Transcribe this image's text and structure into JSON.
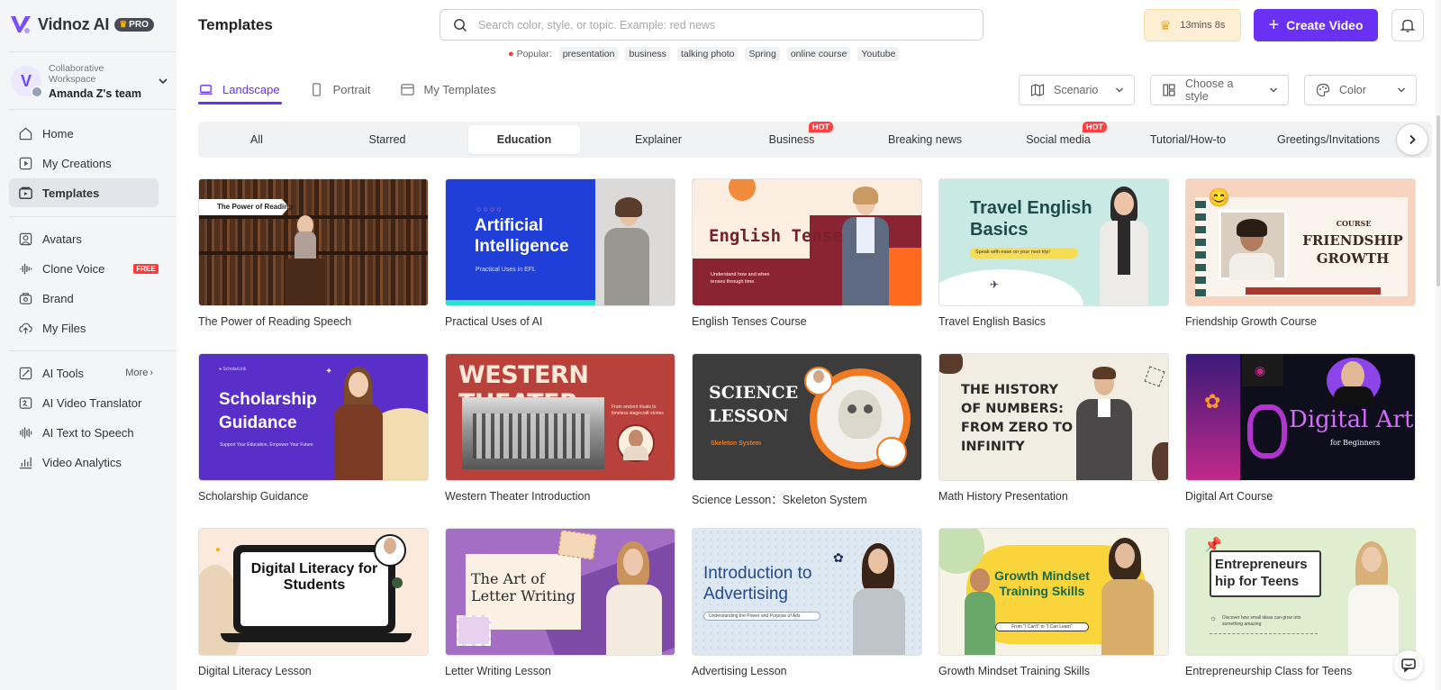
{
  "brand": {
    "name": "Vidnoz AI",
    "badge": "PRO"
  },
  "workspace": {
    "subtitle": "Collaborative Workspace",
    "team": "Amanda Z's team"
  },
  "sidebar": {
    "items": [
      {
        "label": "Home",
        "icon": "home-icon"
      },
      {
        "label": "My Creations",
        "icon": "play-box-icon"
      },
      {
        "label": "Templates",
        "icon": "templates-icon",
        "active": true
      },
      {
        "label": "Avatars",
        "icon": "avatar-icon"
      },
      {
        "label": "Clone Voice",
        "icon": "waveform-icon",
        "badge": "FREE"
      },
      {
        "label": "Brand",
        "icon": "brand-icon"
      },
      {
        "label": "My Files",
        "icon": "cloud-upload-icon"
      },
      {
        "label": "AI Tools",
        "icon": "ai-tools-icon",
        "more": "More"
      },
      {
        "label": "AI Video Translator",
        "icon": "translate-icon"
      },
      {
        "label": "AI Text to Speech",
        "icon": "tts-icon"
      },
      {
        "label": "Video Analytics",
        "icon": "analytics-icon"
      }
    ]
  },
  "header": {
    "title": "Templates",
    "search_placeholder": "Search color, style, or topic. Example: red news",
    "popular_label": "Popular:",
    "popular_tags": [
      "presentation",
      "business",
      "talking photo",
      "Spring",
      "online course",
      "Youtube"
    ],
    "timer": "13mins 8s",
    "create_label": "Create Video"
  },
  "tabs": [
    {
      "label": "Landscape",
      "active": true
    },
    {
      "label": "Portrait"
    },
    {
      "label": "My Templates"
    }
  ],
  "filters": {
    "scenario": "Scenario",
    "style": "Choose a style",
    "color": "Color"
  },
  "categories": [
    {
      "label": "All"
    },
    {
      "label": "Starred"
    },
    {
      "label": "Education",
      "active": true
    },
    {
      "label": "Explainer"
    },
    {
      "label": "Business",
      "hot": "HOT"
    },
    {
      "label": "Breaking news"
    },
    {
      "label": "Social media",
      "hot": "HOT"
    },
    {
      "label": "Tutorial/How-to"
    },
    {
      "label": "Greetings/Invitations"
    }
  ],
  "templates": [
    {
      "title": "The Power of Reading Speech",
      "thumb_text": "The Power of Reading"
    },
    {
      "title": "Practical Uses of AI",
      "thumb_text": "Artificial Intelligence",
      "thumb_sub": "Practical Uses in EFL"
    },
    {
      "title": "English Tenses Course",
      "thumb_text": "English Tenses",
      "thumb_sub": "Understand how and when tenses through time."
    },
    {
      "title": "Travel English Basics",
      "thumb_text": "Travel English Basics",
      "thumb_sub": "Speak with ease on your next trip!"
    },
    {
      "title": "Friendship Growth Course",
      "thumb_small": "COURSE",
      "thumb_text": "FRIENDSHIP GROWTH"
    },
    {
      "title": "Scholarship Guidance",
      "thumb_text": "Scholarship Guidance",
      "thumb_sub": "Support Your Education, Empower Your Future"
    },
    {
      "title": "Western Theater Introduction",
      "thumb_text": "WESTERN THEATER",
      "thumb_sub": "From ancient rituals to timeless stagecraft stories"
    },
    {
      "title": "Science Lesson：Skeleton System",
      "thumb_text": "SCIENCE LESSON",
      "thumb_sub": "Skeleton System"
    },
    {
      "title": "Math History Presentation",
      "thumb_text": "THE HISTORY OF NUMBERS: FROM ZERO TO INFINITY"
    },
    {
      "title": "Digital Art Course",
      "thumb_text": "Digital Art",
      "thumb_sub": "for Beginners"
    },
    {
      "title": "Digital Literacy Lesson",
      "thumb_text": "Digital Literacy for Students"
    },
    {
      "title": "Letter Writing Lesson",
      "thumb_text": "The Art of Letter Writing"
    },
    {
      "title": "Advertising Lesson",
      "thumb_text": "Introduction to Advertising",
      "thumb_sub": "Understanding the Power and Purpose of Ads"
    },
    {
      "title": "Growth Mindset Training Skills",
      "thumb_text": "Growth Mindset Training Skills",
      "thumb_sub": "From \"I Can't\" to \"I Can Learn\""
    },
    {
      "title": "Entrepreneurship Class for Teens",
      "thumb_text": "Entrepreneurs hip for Teens",
      "thumb_sub": "Discover how small ideas can grow into something amazing"
    }
  ],
  "colors": {
    "accent": "#6a31f5",
    "hot": "#ff4040",
    "timer_bg": "#fdeed4"
  }
}
